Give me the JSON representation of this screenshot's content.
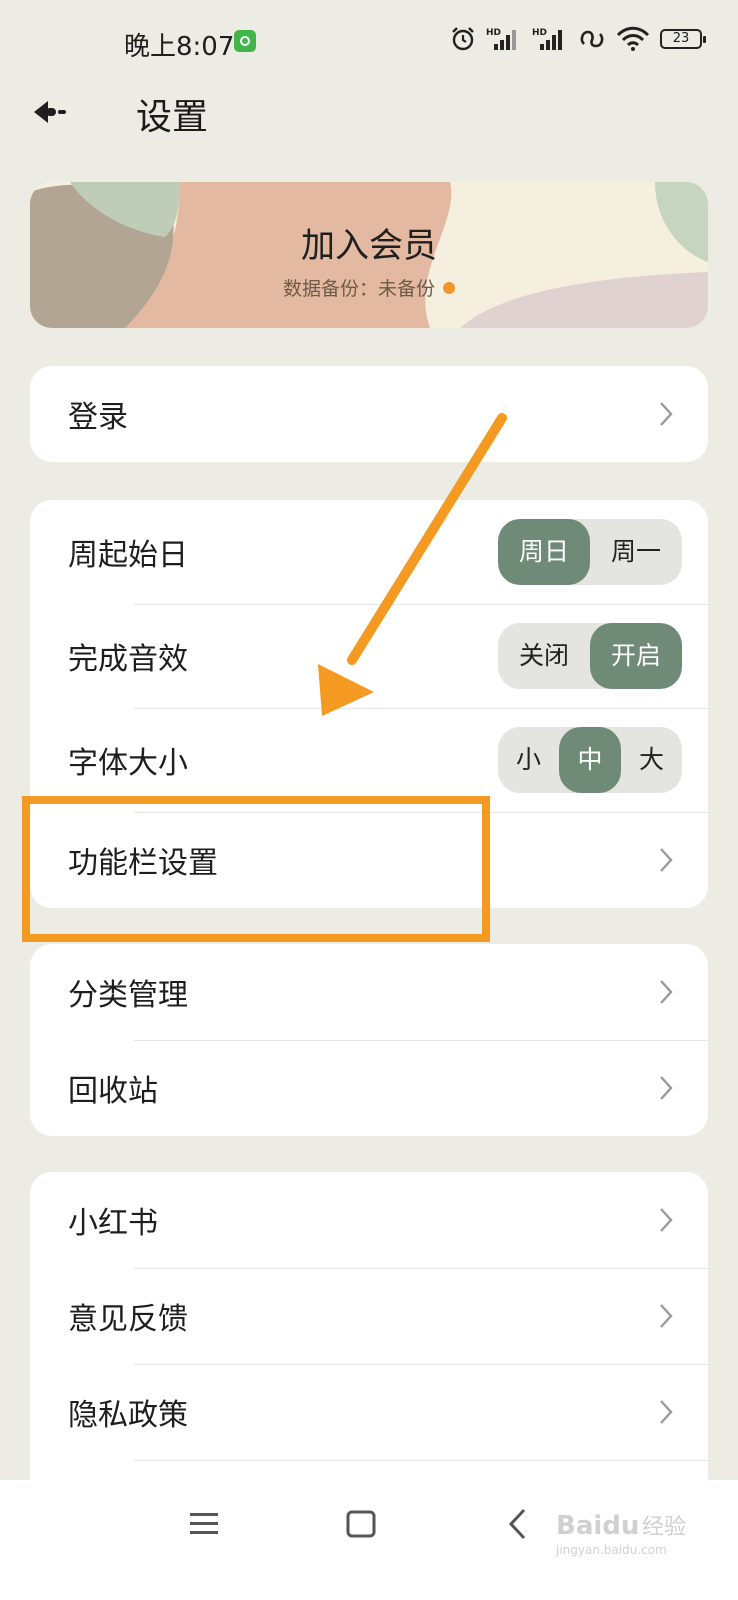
{
  "status_bar": {
    "time": "晚上8:07",
    "battery": "23",
    "icons": [
      "app-notification-icon",
      "alarm-icon",
      "signal-hd-icon",
      "signal-hd-icon",
      "link-icon",
      "wifi-icon",
      "battery-icon"
    ]
  },
  "header": {
    "back_icon": "back-arrow-icon",
    "title": "设置"
  },
  "banner": {
    "title": "加入会员",
    "subtitle": "数据备份：未备份",
    "dot_color": "#f0962a"
  },
  "cards": {
    "login": {
      "label": "登录"
    },
    "prefs": {
      "week_start": {
        "label": "周起始日",
        "options": [
          "周日",
          "周一"
        ],
        "selected": "周日"
      },
      "sound": {
        "label": "完成音效",
        "options": [
          "关闭",
          "开启"
        ],
        "selected": "开启"
      },
      "font_size": {
        "label": "字体大小",
        "options": [
          "小",
          "中",
          "大"
        ],
        "selected": "中"
      },
      "toolbar": {
        "label": "功能栏设置"
      }
    },
    "manage": {
      "category": {
        "label": "分类管理"
      },
      "trash": {
        "label": "回收站"
      }
    },
    "about": {
      "xiaohongshu": {
        "label": "小红书"
      },
      "feedback": {
        "label": "意见反馈"
      },
      "privacy": {
        "label": "隐私政策"
      }
    }
  },
  "nav_bar": {
    "icons": [
      "menu-icon",
      "home-icon",
      "back-icon"
    ],
    "watermark": {
      "brand": "Baidu",
      "text": "经验",
      "url": "jingyan.baidu.com"
    }
  },
  "colors": {
    "background": "#ecebe4",
    "accent_green": "#6f8a76",
    "annotation_orange": "#f49a22"
  }
}
